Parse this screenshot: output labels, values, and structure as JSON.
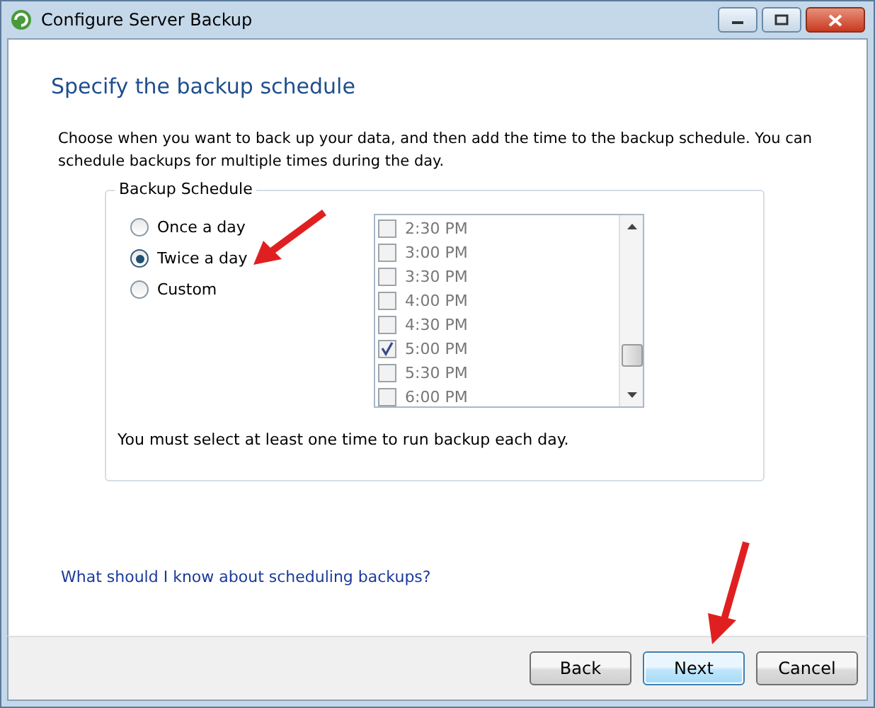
{
  "window": {
    "title": "Configure Server Backup"
  },
  "heading": "Specify the backup schedule",
  "description": "Choose when you want to back up your data, and then add the time to the backup schedule. You can schedule backups for multiple times during the day.",
  "group": {
    "title": "Backup Schedule",
    "options": [
      {
        "label": "Once a day",
        "selected": false
      },
      {
        "label": "Twice a day",
        "selected": true
      },
      {
        "label": "Custom",
        "selected": false
      }
    ],
    "times": [
      {
        "label": "2:30 PM",
        "checked": false
      },
      {
        "label": "3:00 PM",
        "checked": false
      },
      {
        "label": "3:30 PM",
        "checked": false
      },
      {
        "label": "4:00 PM",
        "checked": false
      },
      {
        "label": "4:30 PM",
        "checked": false
      },
      {
        "label": "5:00 PM",
        "checked": true
      },
      {
        "label": "5:30 PM",
        "checked": false
      },
      {
        "label": "6:00 PM",
        "checked": false
      }
    ],
    "note": "You must select at least one time to run backup each day."
  },
  "help_link": "What should I know about scheduling backups?",
  "buttons": [
    {
      "label": "Back",
      "default": false
    },
    {
      "label": "Next",
      "default": true
    },
    {
      "label": "Cancel",
      "default": false
    }
  ]
}
